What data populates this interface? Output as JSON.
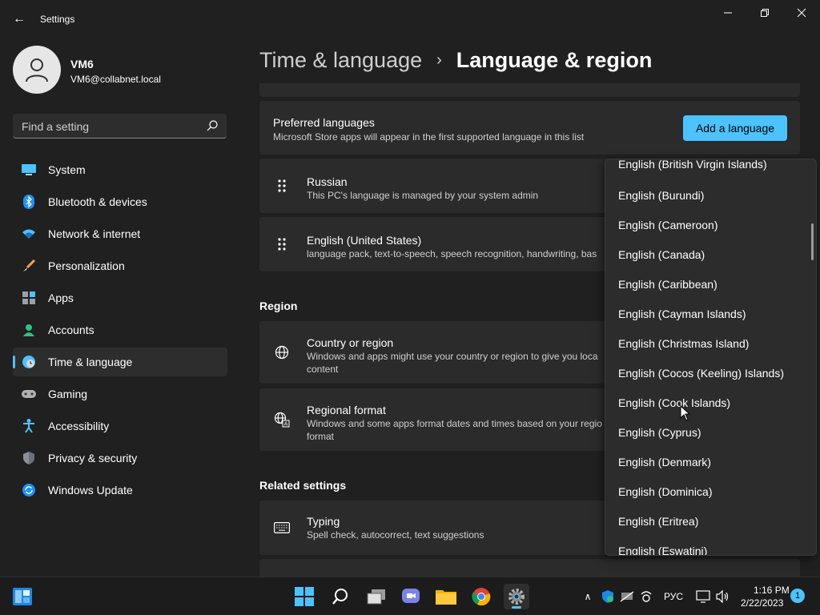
{
  "window": {
    "title": "Settings",
    "back_label": "←",
    "minimize_label": "—",
    "restore_label": "❐",
    "close_label": "✕"
  },
  "profile": {
    "name": "VM6",
    "email": "VM6@collabnet.local"
  },
  "search": {
    "placeholder": "Find a setting"
  },
  "sidebar": {
    "items": [
      {
        "label": "System",
        "icon": "monitor-icon"
      },
      {
        "label": "Bluetooth & devices",
        "icon": "bluetooth-icon"
      },
      {
        "label": "Network & internet",
        "icon": "wifi-icon"
      },
      {
        "label": "Personalization",
        "icon": "brush-icon"
      },
      {
        "label": "Apps",
        "icon": "apps-icon"
      },
      {
        "label": "Accounts",
        "icon": "person-icon"
      },
      {
        "label": "Time & language",
        "icon": "globe-clock-icon",
        "active": true
      },
      {
        "label": "Gaming",
        "icon": "gamepad-icon"
      },
      {
        "label": "Accessibility",
        "icon": "accessibility-icon"
      },
      {
        "label": "Privacy & security",
        "icon": "shield-icon"
      },
      {
        "label": "Windows Update",
        "icon": "update-icon"
      }
    ]
  },
  "header": {
    "parent": "Time & language",
    "separator": "›",
    "current": "Language & region"
  },
  "main": {
    "preferred": {
      "title": "Preferred languages",
      "subtitle": "Microsoft Store apps will appear in the first supported language in this list",
      "button": "Add a language"
    },
    "languages": [
      {
        "title": "Russian",
        "subtitle": "This PC's language is managed by your system admin"
      },
      {
        "title": "English (United States)",
        "subtitle": "language pack, text-to-speech, speech recognition, handwriting, bas"
      }
    ],
    "region_section": "Region",
    "region_items": [
      {
        "title": "Country or region",
        "subtitle": "Windows and apps might use your country or region to give you loca",
        "subtitle2": "content"
      },
      {
        "title": "Regional format",
        "subtitle": "Windows and some apps format dates and times based on your regio",
        "subtitle2": "format"
      }
    ],
    "related_section": "Related settings",
    "related_items": [
      {
        "title": "Typing",
        "subtitle": "Spell check, autocorrect, text suggestions"
      }
    ]
  },
  "dropdown": {
    "items": [
      "English (British Virgin Islands)",
      "English (Burundi)",
      "English (Cameroon)",
      "English (Canada)",
      "English (Caribbean)",
      "English (Cayman Islands)",
      "English (Christmas Island)",
      "English (Cocos (Keeling) Islands)",
      "English (Cook Islands)",
      "English (Cyprus)",
      "English (Denmark)",
      "English (Dominica)",
      "English (Eritrea)",
      "English (Eswatini)"
    ]
  },
  "taskbar": {
    "lang": "РУС",
    "time": "1:16 PM",
    "date": "2/22/2023",
    "notifications": "1",
    "chevron": "∧"
  },
  "colors": {
    "accent": "#4cc2ff",
    "background": "#202020",
    "card": "#2b2b2b"
  }
}
